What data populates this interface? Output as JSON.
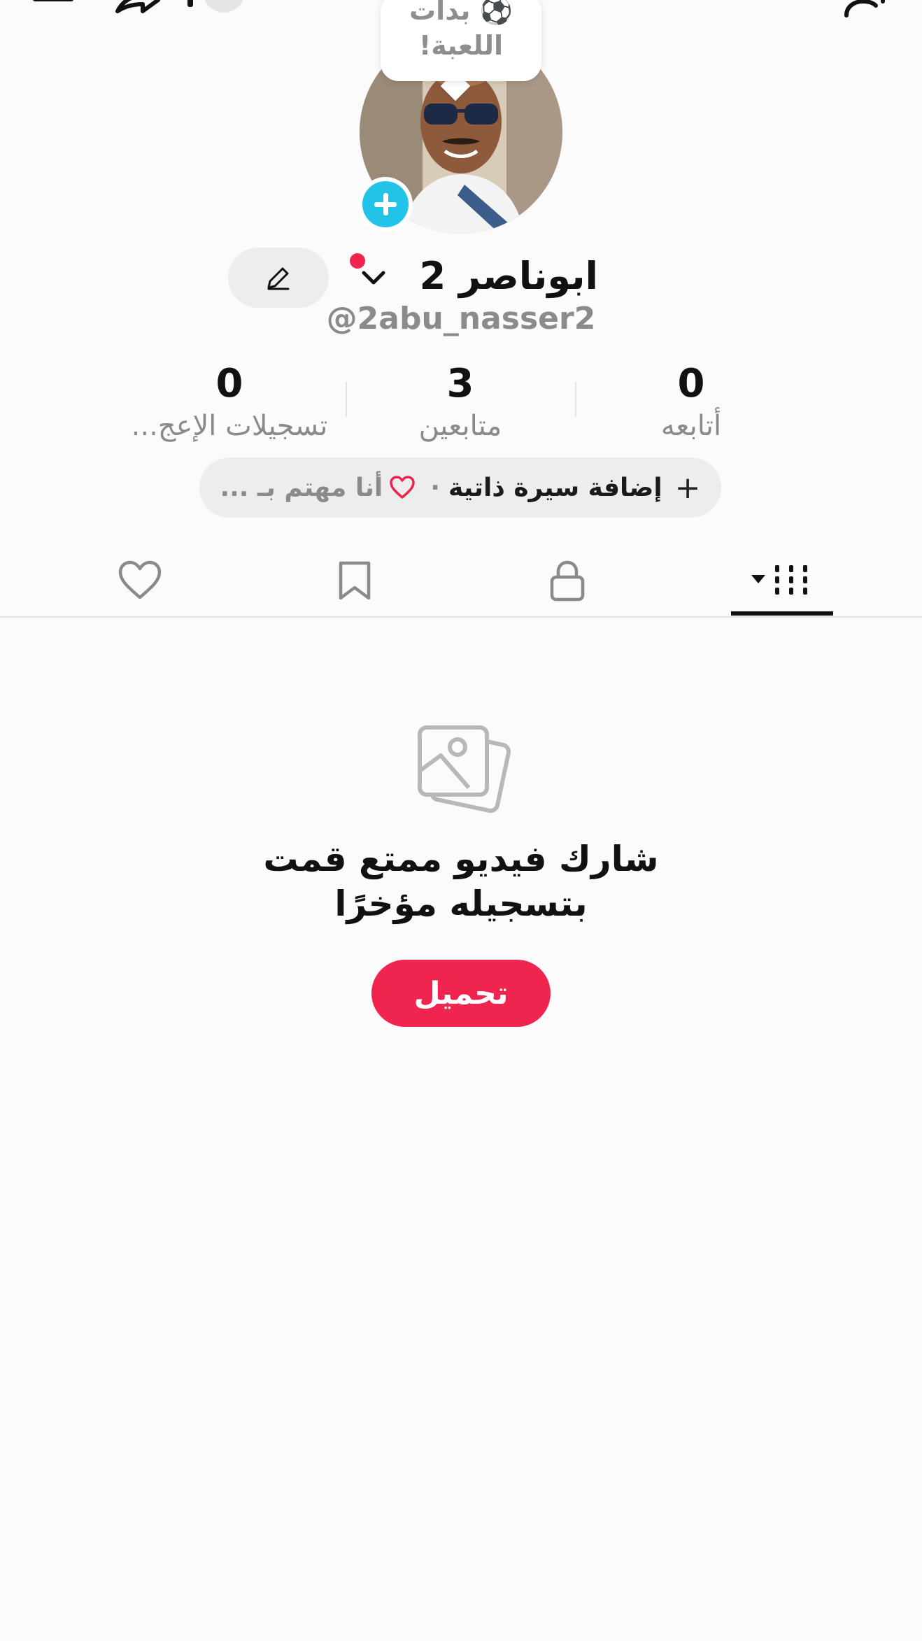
{
  "header": {
    "menu_icon": "menu-icon",
    "share_icon": "share-icon",
    "add_friend_icon": "add-user-icon"
  },
  "profile": {
    "bubble_text_line1": "⚽ بدأت",
    "bubble_text_line2": "اللعبة!",
    "display_name": "ابوناصر 2",
    "username": "@2abu_nasser2",
    "avatar_add_icon": "plus-icon",
    "edit_icon": "pencil-icon"
  },
  "stats": {
    "following": {
      "value": "0",
      "label": "أتابعه"
    },
    "followers": {
      "value": "3",
      "label": "متابعين"
    },
    "likes": {
      "value": "0",
      "label": "تسجيلات الإعج..."
    }
  },
  "bio": {
    "plus": "+",
    "add_label": "إضافة سيرة ذاتية",
    "separator": "·",
    "interest_label": "أنا مهتم بـ ..."
  },
  "tabs": [
    {
      "name": "videos",
      "icon": "grid-icon",
      "active": true
    },
    {
      "name": "private",
      "icon": "lock-icon",
      "active": false
    },
    {
      "name": "saved",
      "icon": "bookmark-icon",
      "active": false
    },
    {
      "name": "liked",
      "icon": "heart-icon",
      "active": false
    }
  ],
  "empty_state": {
    "icon": "photos-icon",
    "title_line1": "شارك فيديو ممتع قمت",
    "title_line2": "بتسجيله مؤخرًا",
    "button_label": "تحميل"
  },
  "colors": {
    "accent_red": "#f0254f",
    "accent_cyan": "#22c3e8",
    "muted_gray": "#8a8a8a",
    "pill_bg": "#eeeded"
  }
}
